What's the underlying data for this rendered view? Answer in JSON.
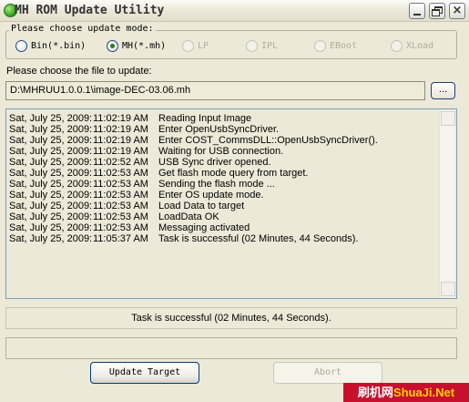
{
  "window": {
    "title": "MH ROM Update Utility",
    "controls": {
      "close_glyph": "×"
    }
  },
  "update_mode": {
    "legend": "Please choose update mode:",
    "options": [
      {
        "label": "Bin(*.bin)",
        "selected": false,
        "enabled": true
      },
      {
        "label": "MH(*.mh)",
        "selected": true,
        "enabled": true
      },
      {
        "label": "LP",
        "selected": false,
        "enabled": false
      },
      {
        "label": "IPL",
        "selected": false,
        "enabled": false
      },
      {
        "label": "EBoot",
        "selected": false,
        "enabled": false
      },
      {
        "label": "XLoad",
        "selected": false,
        "enabled": false
      }
    ]
  },
  "file": {
    "label": "Please choose the file to update:",
    "path": "D:\\MHRUU1.0.0.1\\image-DEC-03.06.mh",
    "browse_label": "..."
  },
  "log": [
    {
      "date": "Sat, July 25, 2009:",
      "time": "11:02:19 AM",
      "message": "Reading Input Image"
    },
    {
      "date": "Sat, July 25, 2009:",
      "time": "11:02:19 AM",
      "message": "Enter OpenUsbSyncDriver."
    },
    {
      "date": "Sat, July 25, 2009:",
      "time": "11:02:19 AM",
      "message": "Enter COST_CommsDLL::OpenUsbSyncDriver()."
    },
    {
      "date": "Sat, July 25, 2009:",
      "time": "11:02:19 AM",
      "message": "Waiting for USB connection."
    },
    {
      "date": "Sat, July 25, 2009:",
      "time": "11:02:52 AM",
      "message": "USB Sync driver opened."
    },
    {
      "date": "Sat, July 25, 2009:",
      "time": "11:02:53 AM",
      "message": "Get flash mode query from target."
    },
    {
      "date": "Sat, July 25, 2009:",
      "time": "11:02:53 AM",
      "message": "Sending the flash mode ..."
    },
    {
      "date": "Sat, July 25, 2009:",
      "time": "11:02:53 AM",
      "message": "Enter OS update mode."
    },
    {
      "date": "Sat, July 25, 2009:",
      "time": "11:02:53 AM",
      "message": "Load Data to  target"
    },
    {
      "date": "Sat, July 25, 2009:",
      "time": "11:02:53 AM",
      "message": "LoadData OK"
    },
    {
      "date": "Sat, July 25, 2009:",
      "time": "11:02:53 AM",
      "message": "Messaging activated"
    },
    {
      "date": "Sat, July 25, 2009:",
      "time": "11:05:37 AM",
      "message": "Task is successful (02 Minutes, 44 Seconds)."
    }
  ],
  "status": {
    "text": "Task is successful (02 Minutes, 44 Seconds)."
  },
  "progress": {
    "percent": 0
  },
  "buttons": {
    "update": "Update Target",
    "abort": "Abort"
  },
  "watermark": {
    "text_a": "刷机网",
    "text_b": "ShuaJi.Net"
  },
  "colors": {
    "window_bg": "#ece9d8",
    "radio_check": "#2b7c1a",
    "watermark_bg": "#c8102e"
  }
}
